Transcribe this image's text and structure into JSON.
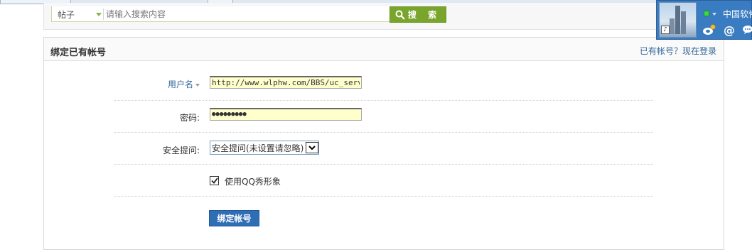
{
  "search": {
    "type_label": "帖子",
    "placeholder": "请输入搜索内容",
    "button_label": "搜 索"
  },
  "panel": {
    "title": "绑定已有帐号",
    "login_link": "已有帐号？现在登录"
  },
  "form": {
    "username_label": "用户名",
    "username_value": "http://www.wlphw.com/BBS/uc_server/",
    "password_label": "密码:",
    "password_value": "●●●●●●●●●",
    "question_label": "安全提问:",
    "question_selected": "安全提问(未设置请忽略)",
    "qq_show_label": "使用QQ秀形象",
    "qq_show_checked": true,
    "submit_label": "绑定帐号"
  },
  "widget": {
    "text": "中国软件"
  },
  "colors": {
    "search_button": "#7aa52c",
    "submit_button": "#2f6db5",
    "link": "#336699",
    "field_bg": "#ffffcc",
    "widget_bg": "#3a7cc2"
  }
}
